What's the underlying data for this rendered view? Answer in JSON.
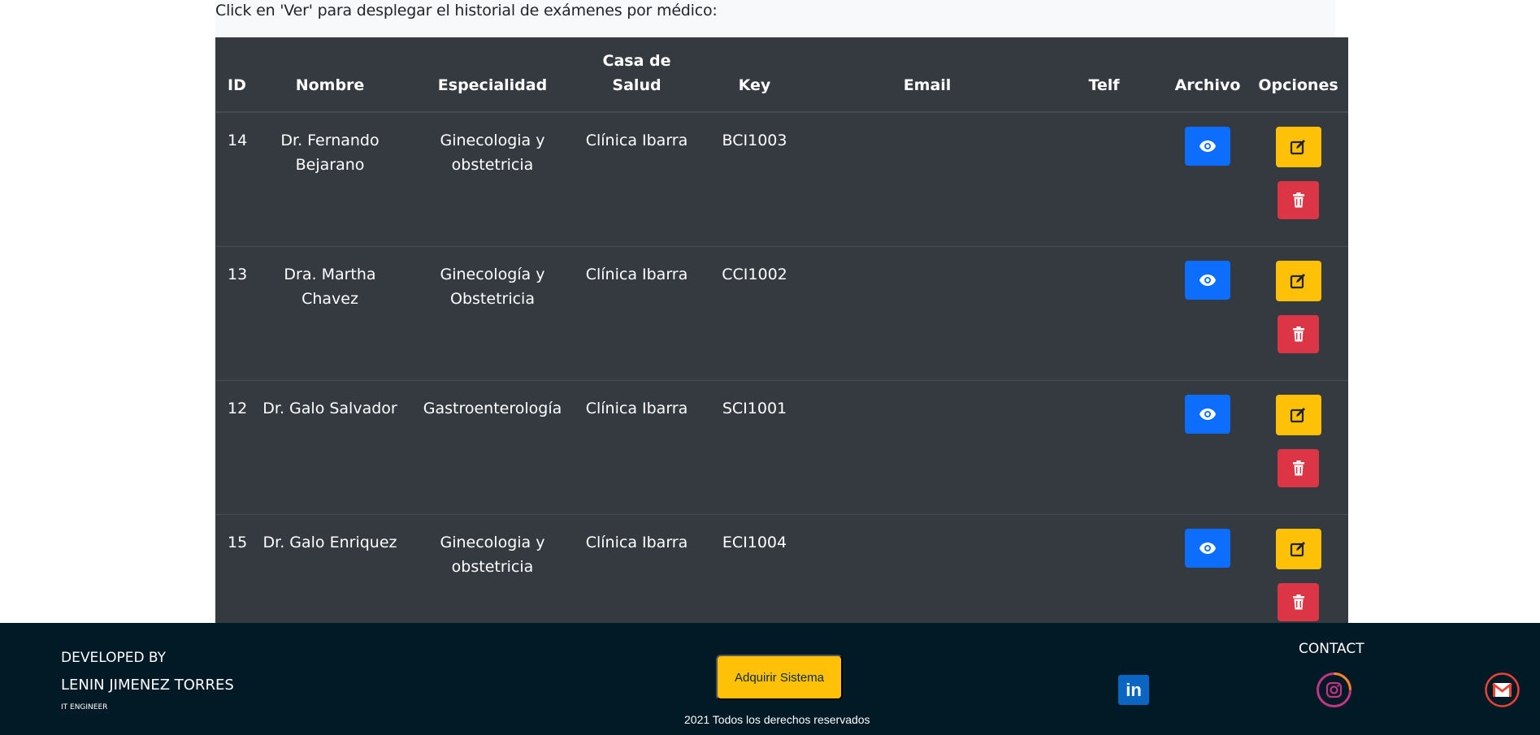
{
  "intro_text": "Click en 'Ver' para desplegar el historial de exámenes por médico:",
  "table": {
    "headers": {
      "id": "ID",
      "nombre": "Nombre",
      "especialidad": "Especialidad",
      "casa_l1": "Casa de",
      "casa_l2": "Salud",
      "key": "Key",
      "email": "Email",
      "telf": "Telf",
      "archivo": "Archivo",
      "opciones": "Opciones"
    },
    "rows": [
      {
        "id": "14",
        "nombre_l1": "Dr. Fernando",
        "nombre_l2": "Bejarano",
        "esp_l1": "Ginecologia y",
        "esp_l2": "obstetricia",
        "casa": "Clínica Ibarra",
        "key": "BCI1003",
        "email": "",
        "telf": ""
      },
      {
        "id": "13",
        "nombre_l1": "Dra. Martha Chavez",
        "nombre_l2": "",
        "esp_l1": "Ginecología y",
        "esp_l2": "Obstetricia",
        "casa": "Clínica Ibarra",
        "key": "CCI1002",
        "email": "",
        "telf": ""
      },
      {
        "id": "12",
        "nombre_l1": "Dr. Galo Salvador",
        "nombre_l2": "",
        "esp_l1": "Gastroenterología",
        "esp_l2": "",
        "casa": "Clínica Ibarra",
        "key": "SCI1001",
        "email": "",
        "telf": ""
      },
      {
        "id": "15",
        "nombre_l1": "Dr. Galo Enriquez",
        "nombre_l2": "",
        "esp_l1": "Ginecologia y",
        "esp_l2": "obstetricia",
        "casa": "Clínica Ibarra",
        "key": "ECI1004",
        "email": "",
        "telf": ""
      }
    ]
  },
  "icons": {
    "view": "eye-icon",
    "edit": "edit-icon",
    "delete": "trash-icon"
  },
  "colors": {
    "view_button": "#0d6efd",
    "edit_button": "#ffc107",
    "delete_button": "#dc3545",
    "table_bg": "#343a40",
    "footer_bg": "#021926"
  },
  "footer": {
    "developed_by": "DEVELOPED BY",
    "developer_name": "LENIN JIMENEZ TORRES",
    "developer_role": "IT ENGINEER",
    "acquire_button": "Adquirir Sistema",
    "rights": "2021 Todos los derechos reservados",
    "contact": "CONTACT",
    "linkedin_label": "in"
  }
}
